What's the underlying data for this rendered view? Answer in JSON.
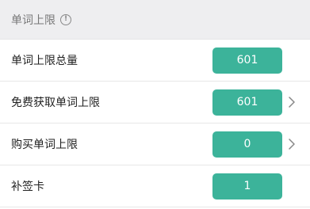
{
  "header": {
    "title": "单词上限",
    "info_icon": "info-circle-icon"
  },
  "rows": [
    {
      "label": "单词上限总量",
      "value": "601",
      "has_chevron": false
    },
    {
      "label": "免费获取单词上限",
      "value": "601",
      "has_chevron": true
    },
    {
      "label": "购买单词上限",
      "value": "0",
      "has_chevron": true
    },
    {
      "label": "补签卡",
      "value": "1",
      "has_chevron": false
    }
  ],
  "colors": {
    "accent": "#3cb39a",
    "header_bg": "#eeeef0"
  }
}
